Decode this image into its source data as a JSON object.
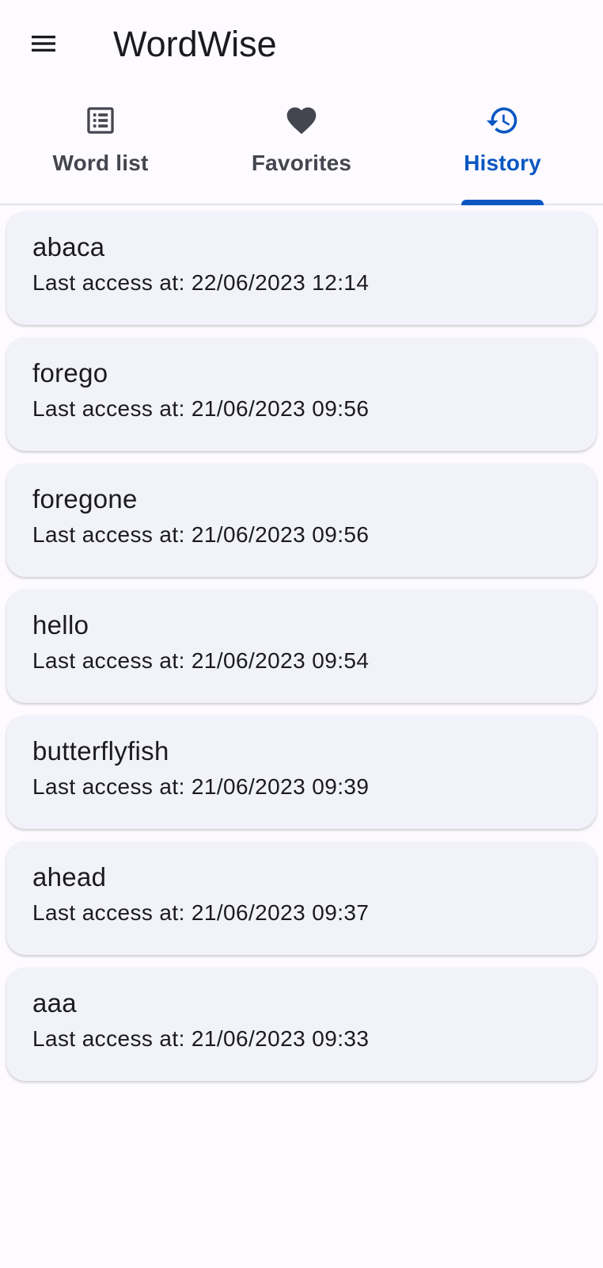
{
  "app": {
    "title": "WordWise"
  },
  "tabs": [
    {
      "label": "Word list",
      "icon": "list-alt-icon",
      "active": false
    },
    {
      "label": "Favorites",
      "icon": "heart-icon",
      "active": false
    },
    {
      "label": "History",
      "icon": "history-icon",
      "active": true
    }
  ],
  "colors": {
    "accent": "#0b57c2",
    "inactive": "#44464f",
    "card_bg": "#f1f2fa",
    "page_bg": "#fdfbff"
  },
  "history": [
    {
      "word": "abaca",
      "last_access": "Last access at: 22/06/2023 12:14"
    },
    {
      "word": "forego",
      "last_access": "Last access at: 21/06/2023 09:56"
    },
    {
      "word": "foregone",
      "last_access": "Last access at: 21/06/2023 09:56"
    },
    {
      "word": "hello",
      "last_access": "Last access at: 21/06/2023 09:54"
    },
    {
      "word": "butterflyfish",
      "last_access": "Last access at: 21/06/2023 09:39"
    },
    {
      "word": "ahead",
      "last_access": "Last access at: 21/06/2023 09:37"
    },
    {
      "word": "aaa",
      "last_access": "Last access at: 21/06/2023 09:33"
    }
  ]
}
